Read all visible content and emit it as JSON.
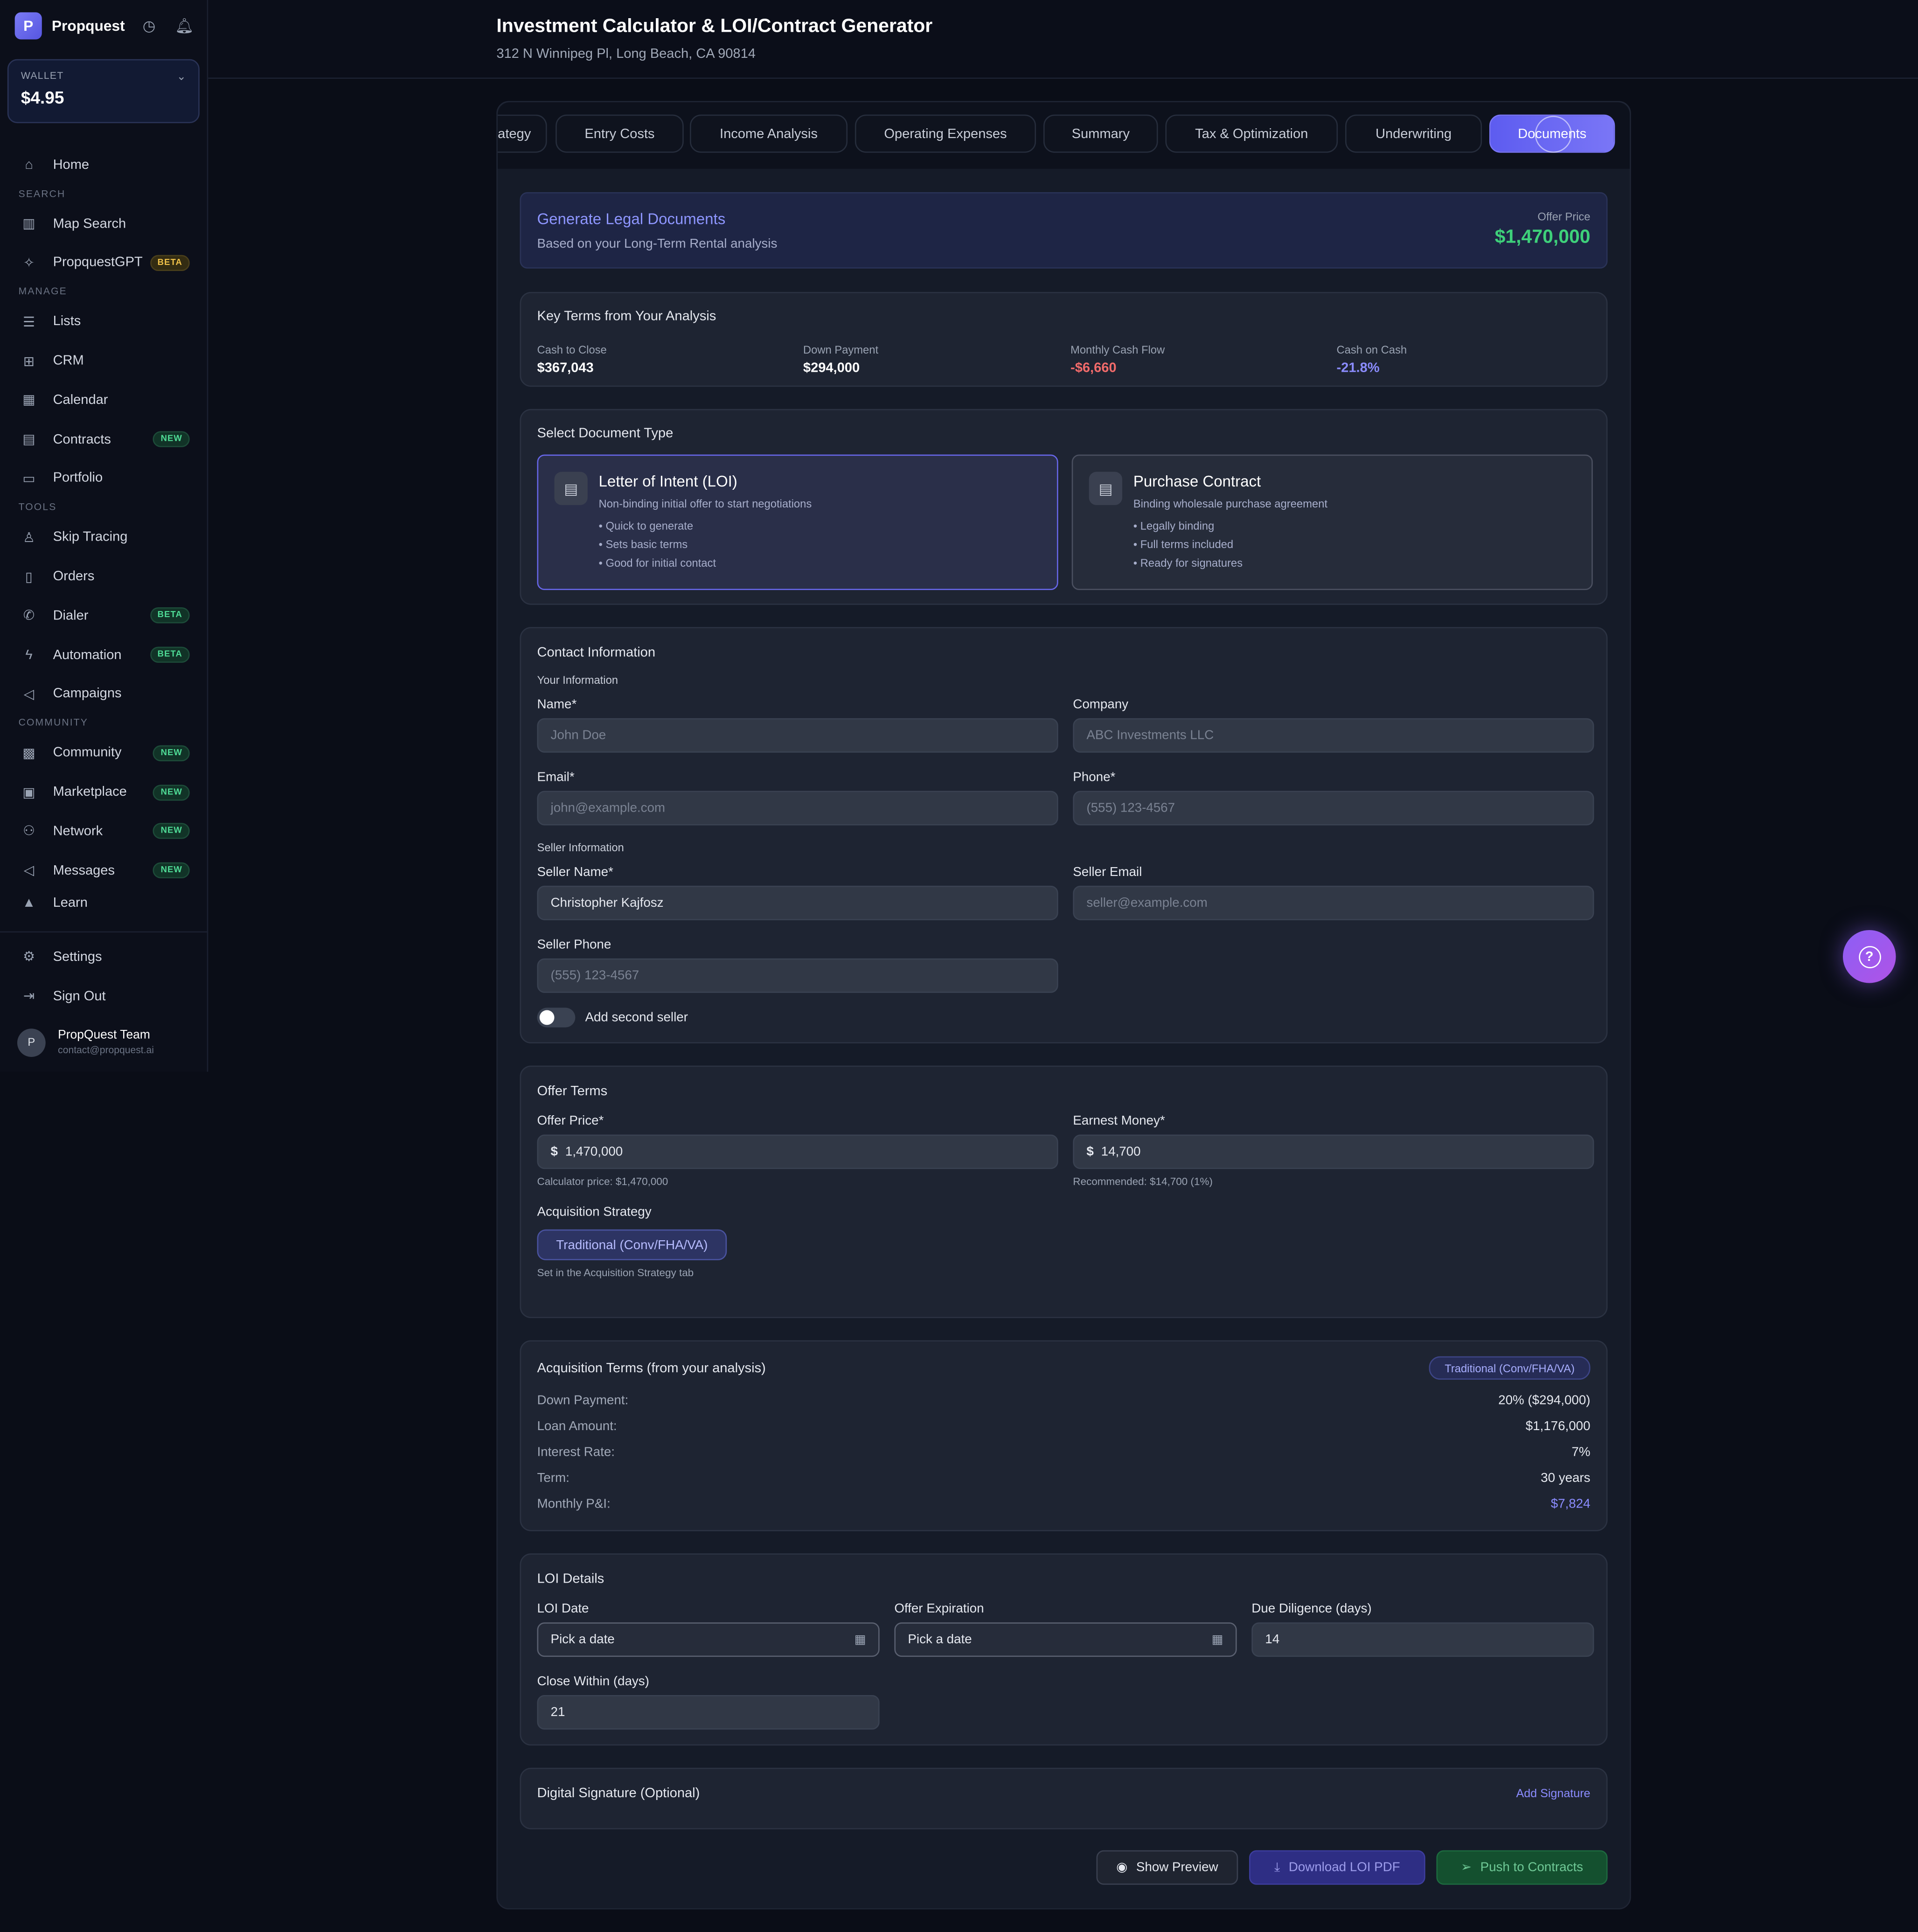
{
  "app": {
    "name": "Propquest",
    "logo_text": "P"
  },
  "wallet": {
    "label": "WALLET",
    "value": "$4.95"
  },
  "sidebar": {
    "home": "Home",
    "sections": {
      "search": "SEARCH",
      "manage": "MANAGE",
      "tools": "TOOLS",
      "community": "COMMUNITY"
    },
    "items": {
      "map_search": "Map Search",
      "propquestgpt": "PropquestGPT",
      "lists": "Lists",
      "crm": "CRM",
      "calendar": "Calendar",
      "contracts": "Contracts",
      "portfolio": "Portfolio",
      "skip_tracing": "Skip Tracing",
      "orders": "Orders",
      "dialer": "Dialer",
      "automation": "Automation",
      "campaigns": "Campaigns",
      "community": "Community",
      "marketplace": "Marketplace",
      "network": "Network",
      "messages": "Messages",
      "learn": "Learn"
    },
    "badges": {
      "beta": "BETA",
      "new": "NEW"
    },
    "settings": "Settings",
    "sign_out": "Sign Out",
    "user": {
      "initial": "P",
      "name": "PropQuest Team",
      "email": "contact@propquest.ai"
    }
  },
  "header": {
    "title": "Investment Calculator & LOI/Contract Generator",
    "address": "312 N Winnipeg Pl, Long Beach, CA 90814"
  },
  "tabs": [
    "ategy",
    "Entry Costs",
    "Income Analysis",
    "Operating Expenses",
    "Summary",
    "Tax & Optimization",
    "Underwriting",
    "Documents"
  ],
  "generate": {
    "title": "Generate Legal Documents",
    "subtitle": "Based on your Long-Term Rental analysis",
    "offer_label": "Offer Price",
    "offer_value": "$1,470,000"
  },
  "key_terms": {
    "title": "Key Terms from Your Analysis",
    "items": [
      {
        "label": "Cash to Close",
        "value": "$367,043",
        "color": "#ffffff"
      },
      {
        "label": "Down Payment",
        "value": "$294,000",
        "color": "#ffffff"
      },
      {
        "label": "Monthly Cash Flow",
        "value": "-$6,660",
        "color": "#f26b6b"
      },
      {
        "label": "Cash on Cash",
        "value": "-21.8%",
        "color": "#8b8cff"
      }
    ]
  },
  "doc_type": {
    "title": "Select Document Type",
    "loi": {
      "title": "Letter of Intent (LOI)",
      "desc": "Non-binding initial offer to start negotiations",
      "bullets": [
        "• Quick to generate",
        "• Sets basic terms",
        "• Good for initial contact"
      ]
    },
    "contract": {
      "title": "Purchase Contract",
      "desc": "Binding wholesale purchase agreement",
      "bullets": [
        "• Legally binding",
        "• Full terms included",
        "• Ready for signatures"
      ]
    }
  },
  "contact": {
    "title": "Contact Information",
    "your_info": "Your Information",
    "name_label": "Name*",
    "name_placeholder": "John Doe",
    "company_label": "Company",
    "company_placeholder": "ABC Investments LLC",
    "email_label": "Email*",
    "email_placeholder": "john@example.com",
    "phone_label": "Phone*",
    "phone_placeholder": "(555) 123-4567",
    "seller_info": "Seller Information",
    "seller_name_label": "Seller Name*",
    "seller_name_value": "Christopher Kajfosz",
    "seller_email_label": "Seller Email",
    "seller_email_placeholder": "seller@example.com",
    "seller_phone_label": "Seller Phone",
    "seller_phone_placeholder": "(555) 123-4567",
    "add_second_seller": "Add second seller"
  },
  "offer_terms": {
    "title": "Offer Terms",
    "offer_price_label": "Offer Price*",
    "offer_price_value": "1,470,000",
    "currency": "$",
    "offer_price_help": "Calculator price: $1,470,000",
    "earnest_label": "Earnest Money*",
    "earnest_value": "14,700",
    "earnest_help": "Recommended: $14,700 (1%)",
    "strategy_label": "Acquisition Strategy",
    "strategy_value": "Traditional (Conv/FHA/VA)",
    "strategy_help": "Set in the Acquisition Strategy tab"
  },
  "acq_terms": {
    "title": "Acquisition Terms (from your analysis)",
    "badge": "Traditional (Conv/FHA/VA)",
    "rows": [
      {
        "label": "Down Payment:",
        "value": "20% ($294,000)"
      },
      {
        "label": "Loan Amount:",
        "value": "$1,176,000"
      },
      {
        "label": "Interest Rate:",
        "value": "7%"
      },
      {
        "label": "Term:",
        "value": "30 years"
      },
      {
        "label": "Monthly P&I:",
        "value": "$7,824"
      }
    ]
  },
  "loi_details": {
    "title": "LOI Details",
    "loi_date_label": "LOI Date",
    "loi_date_value": "Pick a date",
    "expiration_label": "Offer Expiration",
    "expiration_value": "Pick a date",
    "due_diligence_label": "Due Diligence (days)",
    "due_diligence_value": "14",
    "close_within_label": "Close Within (days)",
    "close_within_value": "21"
  },
  "signature": {
    "title": "Digital Signature (Optional)",
    "add": "Add Signature"
  },
  "actions": {
    "preview": "Show Preview",
    "download": "Download LOI PDF",
    "push": "Push to Contracts"
  },
  "colors": {
    "accent": "#6f6ff2",
    "positive": "#3ed07a",
    "negative": "#f26b6b"
  }
}
